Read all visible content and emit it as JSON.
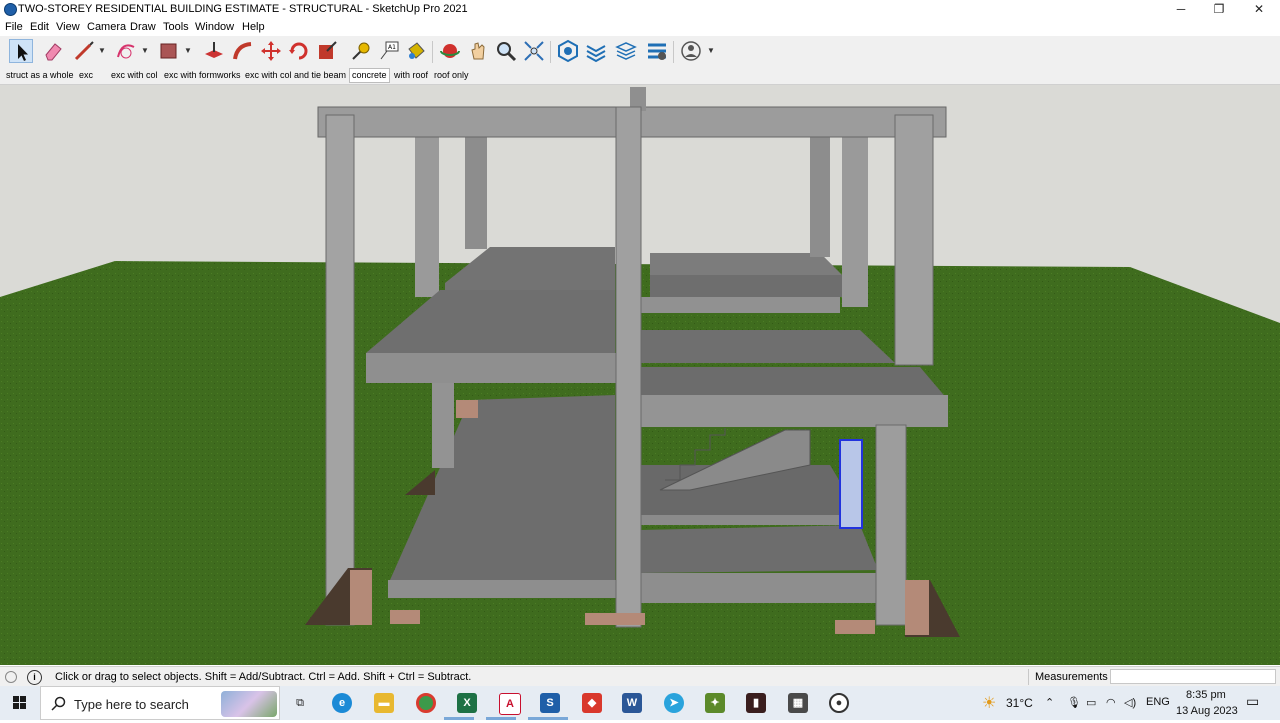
{
  "window": {
    "title": "TWO-STOREY RESIDENTIAL BUILDING ESTIMATE - STRUCTURAL - SketchUp Pro 2021",
    "minimize": "─",
    "restore": "❐",
    "close": "✕"
  },
  "menu": [
    "File",
    "Edit",
    "View",
    "Camera",
    "Draw",
    "Tools",
    "Window",
    "Help"
  ],
  "toolbar": {
    "tools": [
      "select-icon",
      "eraser-icon",
      "line-icon",
      "arc-icon",
      "rectangle-icon",
      "push-pull-icon",
      "follow-me-icon",
      "move-icon",
      "rotate-icon",
      "scale-icon",
      "tape-measure-icon",
      "text-icon",
      "paint-bucket-icon",
      "orbit-icon",
      "pan-icon",
      "zoom-icon",
      "zoom-extents-icon",
      "warehouse-icon",
      "extension-warehouse-icon",
      "layout-icon",
      "extension-manager-icon",
      "account-icon"
    ]
  },
  "scenes": [
    "struct as a whole",
    "exc",
    "exc with col",
    "exc with formworks",
    "exc with col and tie beam",
    "concrete",
    "with roof",
    "roof only"
  ],
  "selected_scene": "concrete",
  "status": {
    "message": "Click or drag to select objects. Shift = Add/Subtract. Ctrl = Add. Shift + Ctrl = Subtract.",
    "measurements_label": "Measurements",
    "measurements_value": ""
  },
  "taskbar": {
    "search_placeholder": "Type here to search",
    "weather": "31°C",
    "language": "ENG",
    "time": "8:35 pm",
    "date": "13 Aug 2023"
  },
  "colors": {
    "sky": "#d8d8d4",
    "grass": "#3e6b1c",
    "concrete": "#8e8e8e",
    "slab": "#707070",
    "accent": "#1f5fa8"
  }
}
